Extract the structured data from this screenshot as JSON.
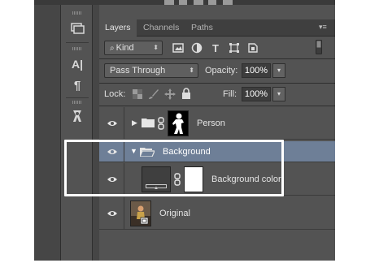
{
  "tabs": [
    {
      "label": "Layers",
      "active": true
    },
    {
      "label": "Channels",
      "active": false
    },
    {
      "label": "Paths",
      "active": false
    }
  ],
  "filter": {
    "label": "Kind"
  },
  "blend": {
    "mode": "Pass Through",
    "opacity_label": "Opacity:",
    "opacity_value": "100%"
  },
  "lock": {
    "label": "Lock:",
    "fill_label": "Fill:",
    "fill_value": "100%"
  },
  "tools": {
    "char_glyph": "A|",
    "para_glyph": "¶"
  },
  "layers": [
    {
      "name": "Person",
      "type": "group",
      "collapsed": true
    },
    {
      "name": "Background",
      "type": "group",
      "expanded": true,
      "selected": true
    },
    {
      "name": "Background color",
      "type": "fill"
    },
    {
      "name": "Original",
      "type": "pixel"
    }
  ],
  "colors": {
    "panel": "#535353",
    "selected_row": "#6e7f97",
    "highlight": "#ffffff"
  }
}
